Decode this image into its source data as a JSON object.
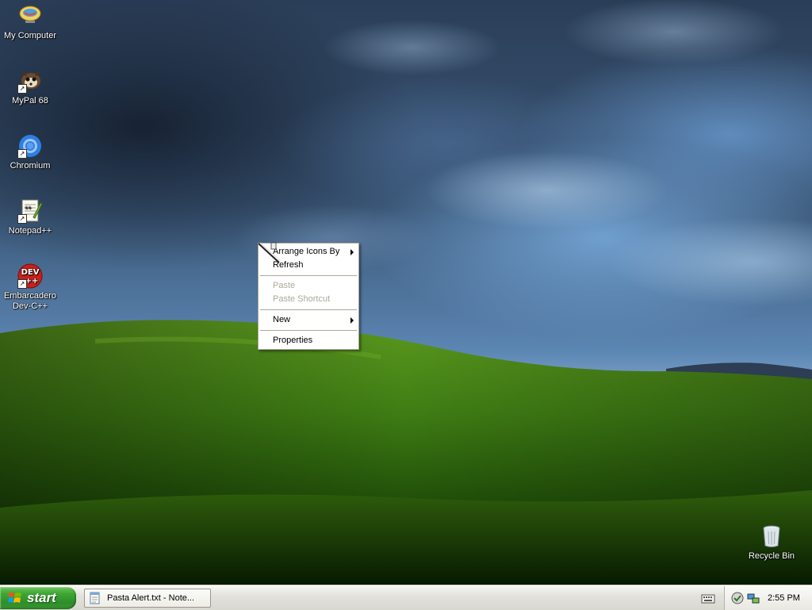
{
  "desktop": {
    "icons": [
      {
        "label": "My Computer",
        "icon": "my-computer-icon"
      },
      {
        "label": "MyPal 68",
        "icon": "mypal-icon"
      },
      {
        "label": "Chromium",
        "icon": "chromium-icon"
      },
      {
        "label": "Notepad++",
        "icon": "notepadpp-icon"
      },
      {
        "label": "Embarcadero Dev-C++",
        "icon": "devcpp-icon"
      },
      {
        "label": "Recycle Bin",
        "icon": "recycle-bin-icon"
      }
    ]
  },
  "context_menu": {
    "items": [
      {
        "label": "Arrange Icons By",
        "submenu": true,
        "enabled": true
      },
      {
        "label": "Refresh",
        "submenu": false,
        "enabled": true
      },
      {
        "label": "Paste",
        "submenu": false,
        "enabled": false
      },
      {
        "label": "Paste Shortcut",
        "submenu": false,
        "enabled": false
      },
      {
        "label": "New",
        "submenu": true,
        "enabled": true
      },
      {
        "label": "Properties",
        "submenu": false,
        "enabled": true
      }
    ]
  },
  "taskbar": {
    "start_label": "start",
    "tasks": [
      {
        "title": "Pasta Alert.txt - Note...",
        "icon": "notepad-icon"
      }
    ],
    "clock": "2:55 PM"
  },
  "colors": {
    "taskbar": "#e3e2dc",
    "start_green": "#3fa635",
    "menu_border": "#aca899",
    "disabled_text": "#aca899"
  }
}
